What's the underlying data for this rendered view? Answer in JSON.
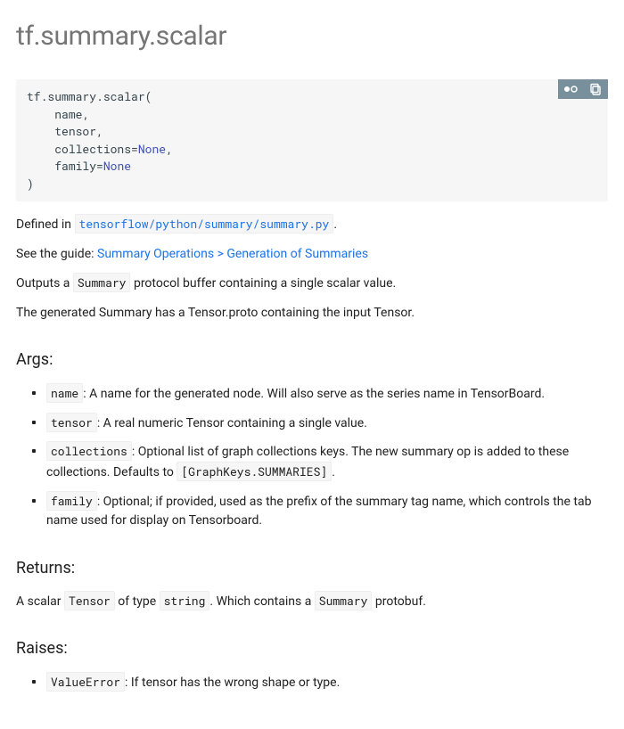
{
  "title": "tf.summary.scalar",
  "signature": {
    "fn": "tf.summary.scalar",
    "open": "(",
    "params": [
      "name",
      "tensor"
    ],
    "kwparams": [
      {
        "name": "collections",
        "eq": "=",
        "val": "None"
      },
      {
        "name": "family",
        "eq": "=",
        "val": "None"
      }
    ],
    "close": ")"
  },
  "defined_in": {
    "prefix": "Defined in ",
    "link": "tensorflow/python/summary/summary.py",
    "suffix": "."
  },
  "guide": {
    "prefix": "See the guide: ",
    "link": "Summary Operations > Generation of Summaries"
  },
  "desc1": {
    "a": "Outputs a ",
    "code": "Summary",
    "b": " protocol buffer containing a single scalar value."
  },
  "desc2": "The generated Summary has a Tensor.proto containing the input Tensor.",
  "args_heading": "Args:",
  "args": [
    {
      "code": "name",
      "text": ": A name for the generated node. Will also serve as the series name in TensorBoard."
    },
    {
      "code": "tensor",
      "text": ": A real numeric Tensor containing a single value."
    },
    {
      "code": "collections",
      "text": ": Optional list of graph collections keys. The new summary op is added to these collections. Defaults to ",
      "code2": "[GraphKeys.SUMMARIES]",
      "suffix": "."
    },
    {
      "code": "family",
      "text": ": Optional; if provided, used as the prefix of the summary tag name, which controls the tab name used for display on Tensorboard."
    }
  ],
  "returns_heading": "Returns:",
  "returns": {
    "a": "A scalar ",
    "c1": "Tensor",
    "b": " of type ",
    "c2": "string",
    "c": ". Which contains a ",
    "c3": "Summary",
    "d": " protobuf."
  },
  "raises_heading": "Raises:",
  "raises": [
    {
      "code": "ValueError",
      "text": ": If tensor has the wrong shape or type."
    }
  ]
}
